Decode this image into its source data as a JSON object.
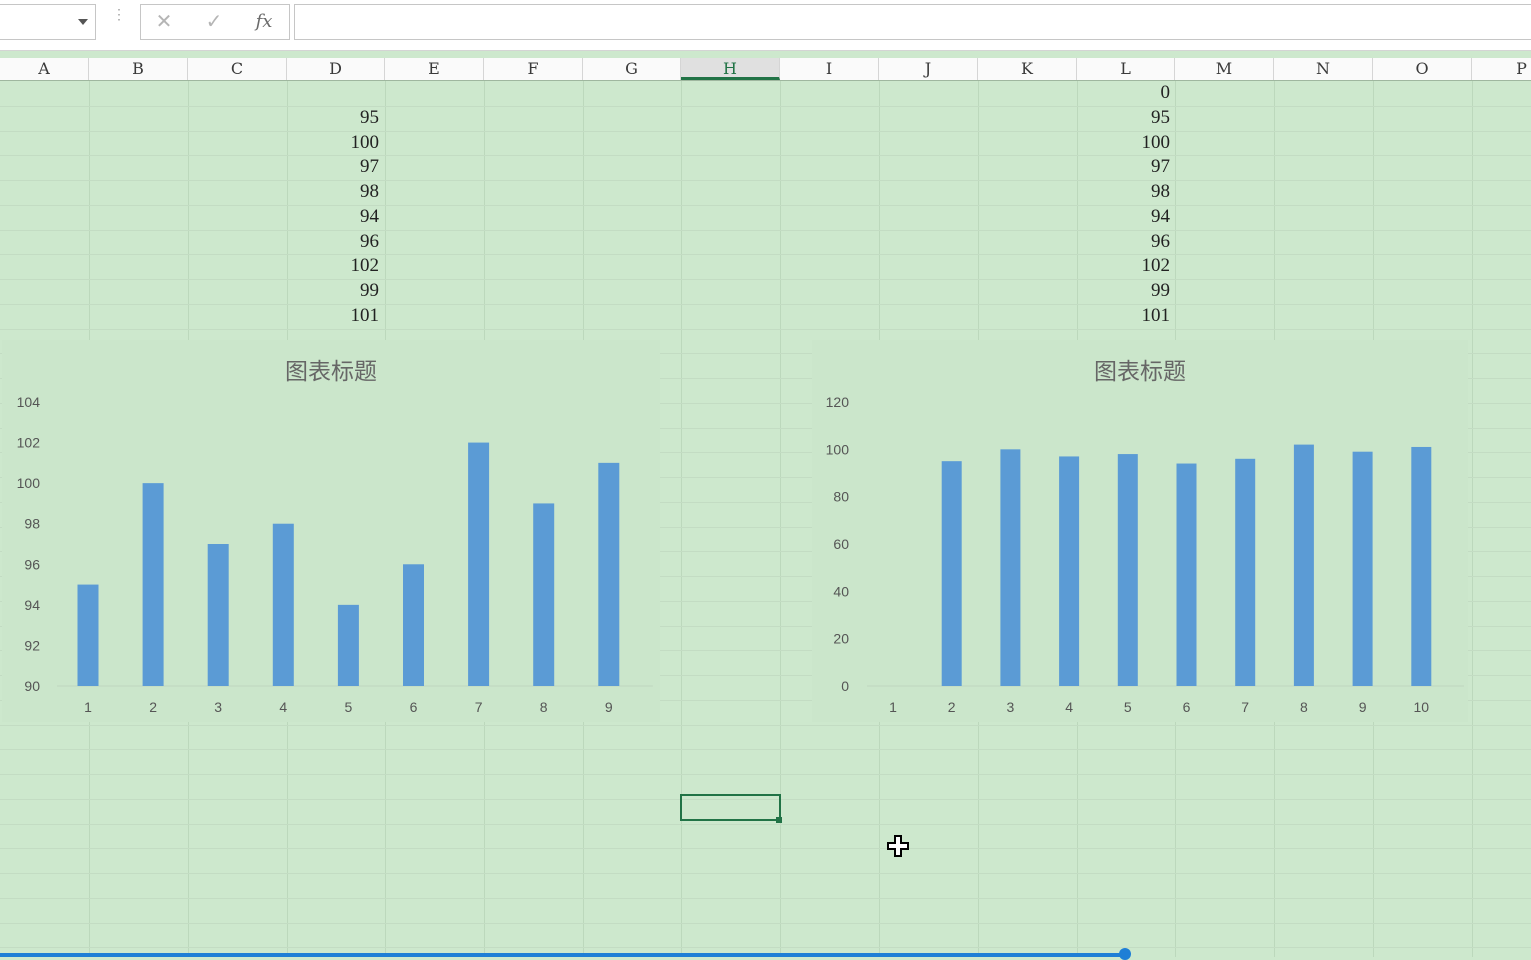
{
  "formula_bar": {
    "name_box_value": "",
    "cancel_symbol": "✕",
    "confirm_symbol": "✓",
    "fx_label": "fx",
    "formula_value": ""
  },
  "columns": [
    "A",
    "B",
    "C",
    "D",
    "E",
    "F",
    "G",
    "H",
    "I",
    "J",
    "K",
    "L",
    "M",
    "N",
    "O",
    "P"
  ],
  "active_column": "H",
  "column_D_values": [
    "95",
    "100",
    "97",
    "98",
    "94",
    "96",
    "102",
    "99",
    "101"
  ],
  "column_L_values": [
    "0",
    "95",
    "100",
    "97",
    "98",
    "94",
    "96",
    "102",
    "99",
    "101"
  ],
  "selected_cell": "H30",
  "colors": {
    "bar": "#5b9bd5",
    "sheet_bg": "#cde8cd",
    "select": "#217346"
  },
  "chart_data": [
    {
      "type": "bar",
      "title": "图表标题",
      "categories": [
        "1",
        "2",
        "3",
        "4",
        "5",
        "6",
        "7",
        "8",
        "9"
      ],
      "values": [
        95,
        100,
        97,
        98,
        94,
        96,
        102,
        99,
        101
      ],
      "ylim": [
        90,
        104
      ],
      "yticks": [
        "90",
        "92",
        "94",
        "96",
        "98",
        "100",
        "102",
        "104"
      ],
      "xlabel": "",
      "ylabel": "",
      "grid": false
    },
    {
      "type": "bar",
      "title": "图表标题",
      "categories": [
        "1",
        "2",
        "3",
        "4",
        "5",
        "6",
        "7",
        "8",
        "9",
        "10"
      ],
      "values": [
        0,
        95,
        100,
        97,
        98,
        94,
        96,
        102,
        99,
        101
      ],
      "ylim": [
        0,
        120
      ],
      "yticks": [
        "0",
        "20",
        "40",
        "60",
        "80",
        "100",
        "120"
      ],
      "xlabel": "",
      "ylabel": "",
      "grid": false
    }
  ]
}
